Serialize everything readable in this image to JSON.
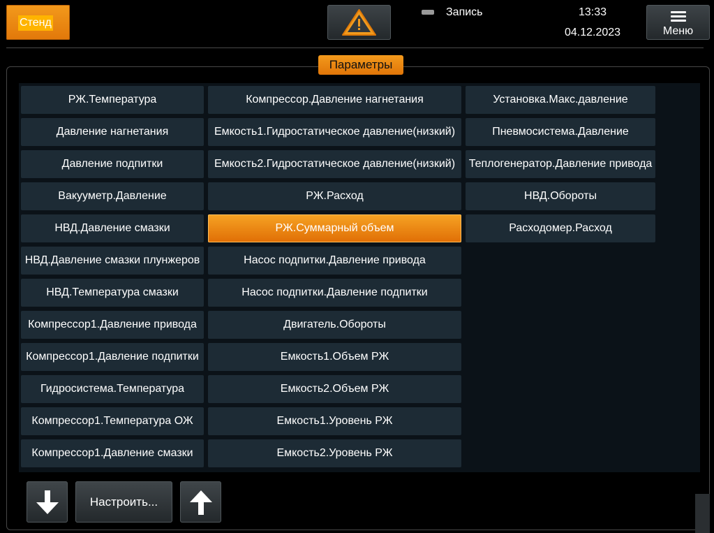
{
  "header": {
    "stend_label": "Стенд",
    "record_label": "Запись",
    "time": "13:33",
    "date": "04.12.2023",
    "menu_label": "Меню"
  },
  "panel": {
    "title": "Параметры"
  },
  "params": {
    "col0": [
      "РЖ.Температура",
      "Давление нагнетания",
      "Давление подпитки",
      "Вакууметр.Давление",
      "НВД.Давление смазки",
      "НВД.Давление смазки плунжеров",
      "НВД.Температура смазки",
      "Компрессор1.Давление привода",
      "Компрессор1.Давление подпитки",
      "Гидросистема.Температура",
      "Компрессор1.Температура ОЖ",
      "Компрессор1.Давление смазки"
    ],
    "col1": [
      "Компрессор.Давление нагнетания",
      "Емкость1.Гидростатическое давление(низкий)",
      "Емкость2.Гидростатическое давление(низкий)",
      "РЖ.Расход",
      "РЖ.Суммарный объем",
      "Насос подпитки.Давление привода",
      "Насос подпитки.Давление подпитки",
      "Двигатель.Обороты",
      "Емкость1.Объем РЖ",
      "Емкость2.Объем РЖ",
      "Емкость1.Уровень РЖ",
      "Емкость2.Уровень РЖ"
    ],
    "col2": [
      "Установка.Макс.давление",
      "Пневмосистема.Давление",
      "Теплогенератор.Давление привода",
      "НВД.Обороты",
      "Расходомер.Расход"
    ],
    "selected": "РЖ.Суммарный объем"
  },
  "footer": {
    "setup_label": "Настроить..."
  },
  "icons": {
    "warning": "warning-icon",
    "menu": "hamburger-icon",
    "down": "arrow-down-icon",
    "up": "arrow-up-icon"
  },
  "colors": {
    "accent": "#f0901a",
    "cell_bg": "#1d2b35",
    "button_bg": "#2f3538"
  }
}
